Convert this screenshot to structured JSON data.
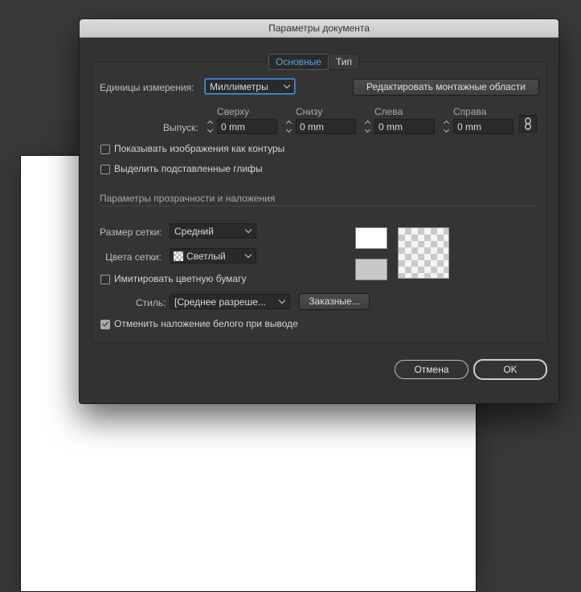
{
  "dialog": {
    "title": "Параметры документа",
    "tabs": [
      {
        "label": "Основные",
        "active": true
      },
      {
        "label": "Тип",
        "active": false
      }
    ]
  },
  "units": {
    "label": "Единицы измерения:",
    "value": "Миллиметры",
    "edit_artboards_button": "Редактировать монтажные области"
  },
  "bleed": {
    "label": "Выпуск:",
    "columns": [
      {
        "header": "Сверху",
        "value": "0 mm"
      },
      {
        "header": "Снизу",
        "value": "0 mm"
      },
      {
        "header": "Слева",
        "value": "0 mm"
      },
      {
        "header": "Справа",
        "value": "0 mm"
      }
    ],
    "link_icon": "chain-link-icon"
  },
  "checkboxes_top": [
    {
      "label": "Показывать изображения как контуры",
      "checked": false
    },
    {
      "label": "Выделить подставленные глифы",
      "checked": false
    }
  ],
  "transparency": {
    "section_title": "Параметры прозрачности и наложения",
    "grid_size_label": "Размер сетки:",
    "grid_size_value": "Средний",
    "grid_colors_label": "Цвета сетки:",
    "grid_colors_value": "Светлый",
    "simulate_paper_label": "Имитировать цветную бумагу",
    "simulate_paper_checked": false,
    "style_label": "Стиль:",
    "style_value": "[Среднее разреше...",
    "custom_button": "Заказные...",
    "discard_white_overprint_label": "Отменить наложение белого при выводе",
    "discard_white_overprint_checked": true,
    "swatch_top_color": "#ffffff",
    "swatch_bottom_color": "#c8c8c8"
  },
  "buttons": {
    "cancel": "Отмена",
    "ok": "OK"
  },
  "colors": {
    "background": "#3a3a3a",
    "dialog": "#323232",
    "accent_tab": "#5aa3e8",
    "focus": "#4a90e2"
  }
}
